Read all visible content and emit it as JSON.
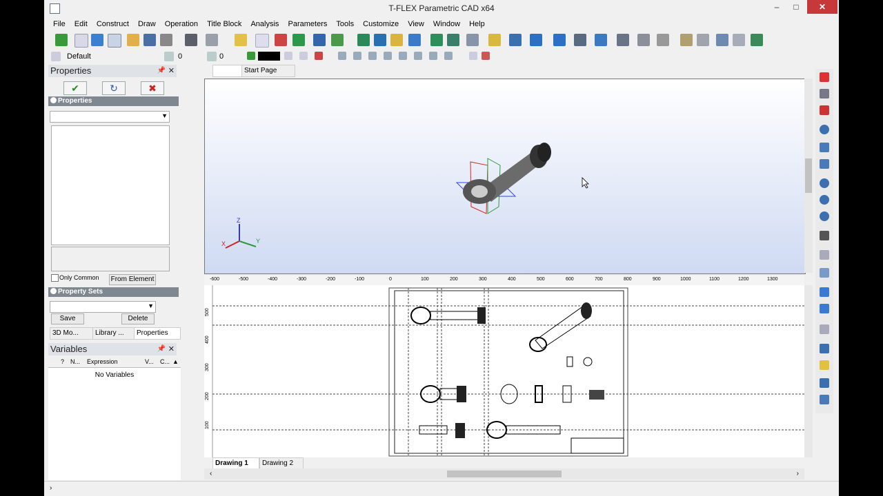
{
  "window": {
    "title": "T-FLEX Parametric CAD x64",
    "minimize": "–",
    "maximize": "□",
    "close": "✕"
  },
  "menu": [
    "File",
    "Edit",
    "Construct",
    "Draw",
    "Operation",
    "Title Block",
    "Analysis",
    "Parameters",
    "Tools",
    "Customize",
    "View",
    "Window",
    "Help"
  ],
  "style_bar": {
    "layer": "Default",
    "value1": "0",
    "value2": "0"
  },
  "properties_panel": {
    "title": "Properties",
    "ok_icon": "✔",
    "refresh_icon": "↻",
    "cancel_icon": "✖",
    "section_properties": "Properties",
    "only_common": "Only Common",
    "from_element": "From Element",
    "section_property_sets": "Property Sets",
    "save": "Save",
    "delete": "Delete",
    "tabs": [
      "3D Mo...",
      "Library ...",
      "Properties"
    ]
  },
  "variables_panel": {
    "title": "Variables",
    "columns": [
      "",
      "?",
      "N...",
      "Expression",
      "V...",
      "C...",
      "▲"
    ],
    "empty_text": "No Variables"
  },
  "document_tabs": [
    "",
    "Start Page"
  ],
  "ruler_labels": [
    "-600",
    "-500",
    "-400",
    "-300",
    "-200",
    "-100",
    "0",
    "100",
    "200",
    "300",
    "400",
    "500",
    "600",
    "700",
    "800",
    "900",
    "1000",
    "1100",
    "1200",
    "1300"
  ],
  "vertical_ruler_labels": [
    "500",
    "400",
    "300",
    "200",
    "100"
  ],
  "drawing_tabs": [
    "Drawing 1",
    "Drawing 2"
  ],
  "axes": {
    "z": "Z",
    "x": "X",
    "y": "Y"
  },
  "colors": {
    "accent": "#7f8790",
    "close": "#c7383a",
    "model": "#555555"
  }
}
